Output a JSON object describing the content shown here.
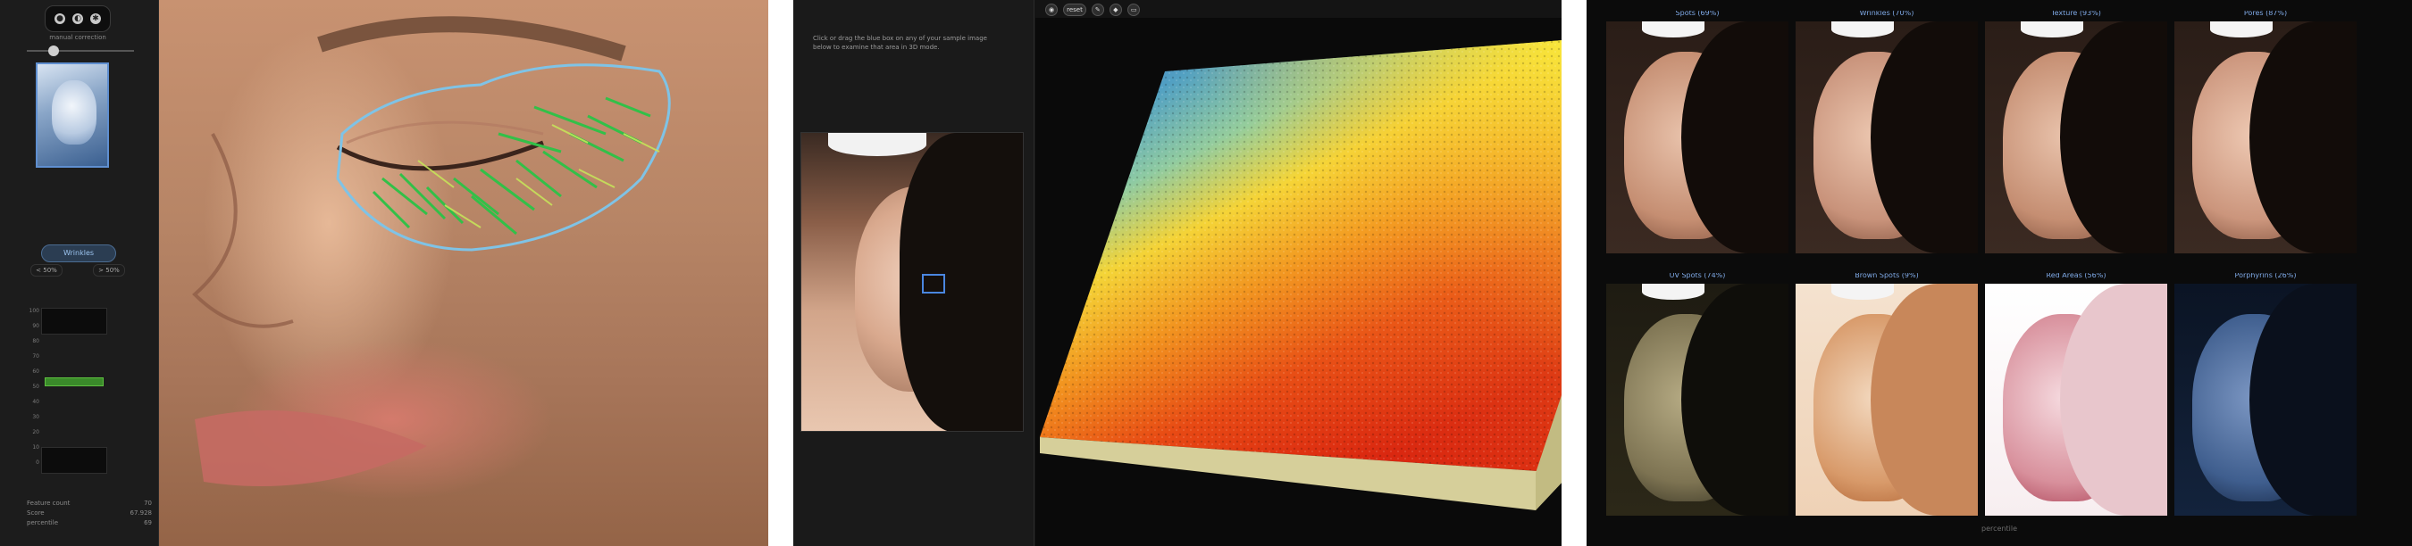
{
  "panel1": {
    "toolbar_label": "manual correction",
    "toolbar_icons": [
      "person-icon",
      "contrast-icon",
      "gear-icon"
    ],
    "feature_pill": "Wrinkles",
    "range_left": "< 50%",
    "range_right": "> 50%",
    "axis_ticks": [
      "100",
      "90",
      "80",
      "70",
      "60",
      "50",
      "40",
      "30",
      "20",
      "10",
      "0"
    ],
    "stats": [
      {
        "label": "Feature count",
        "value": "70"
      },
      {
        "label": "Score",
        "value": "67.928"
      },
      {
        "label": "percentile",
        "value": "69"
      }
    ],
    "accent_color": "#9cc4ef",
    "wrinkle_color": "#32c048",
    "outline_color": "#7fc3e6"
  },
  "panel2": {
    "instructions": "Click or drag the blue box on any of your sample image below to examine that area in 3D mode.",
    "toolbar": [
      "view-icon",
      "reset",
      "wand-icon",
      "palette-icon",
      "folder-icon"
    ],
    "base_color": "#d6cf9a"
  },
  "panel3": {
    "tiles": [
      {
        "label": "Spots (69%)",
        "style": "visible"
      },
      {
        "label": "Wrinkles (70%)",
        "style": "visible"
      },
      {
        "label": "Texture (93%)",
        "style": "visible"
      },
      {
        "label": "Pores (87%)",
        "style": "visible"
      },
      {
        "label": "UV Spots (74%)",
        "style": "uv"
      },
      {
        "label": "Brown Spots (9%)",
        "style": "brown"
      },
      {
        "label": "Red Areas (56%)",
        "style": "red"
      },
      {
        "label": "Porphyrins (26%)",
        "style": "porph"
      }
    ],
    "footer": "percentile",
    "label_color": "#7fa9e6"
  }
}
